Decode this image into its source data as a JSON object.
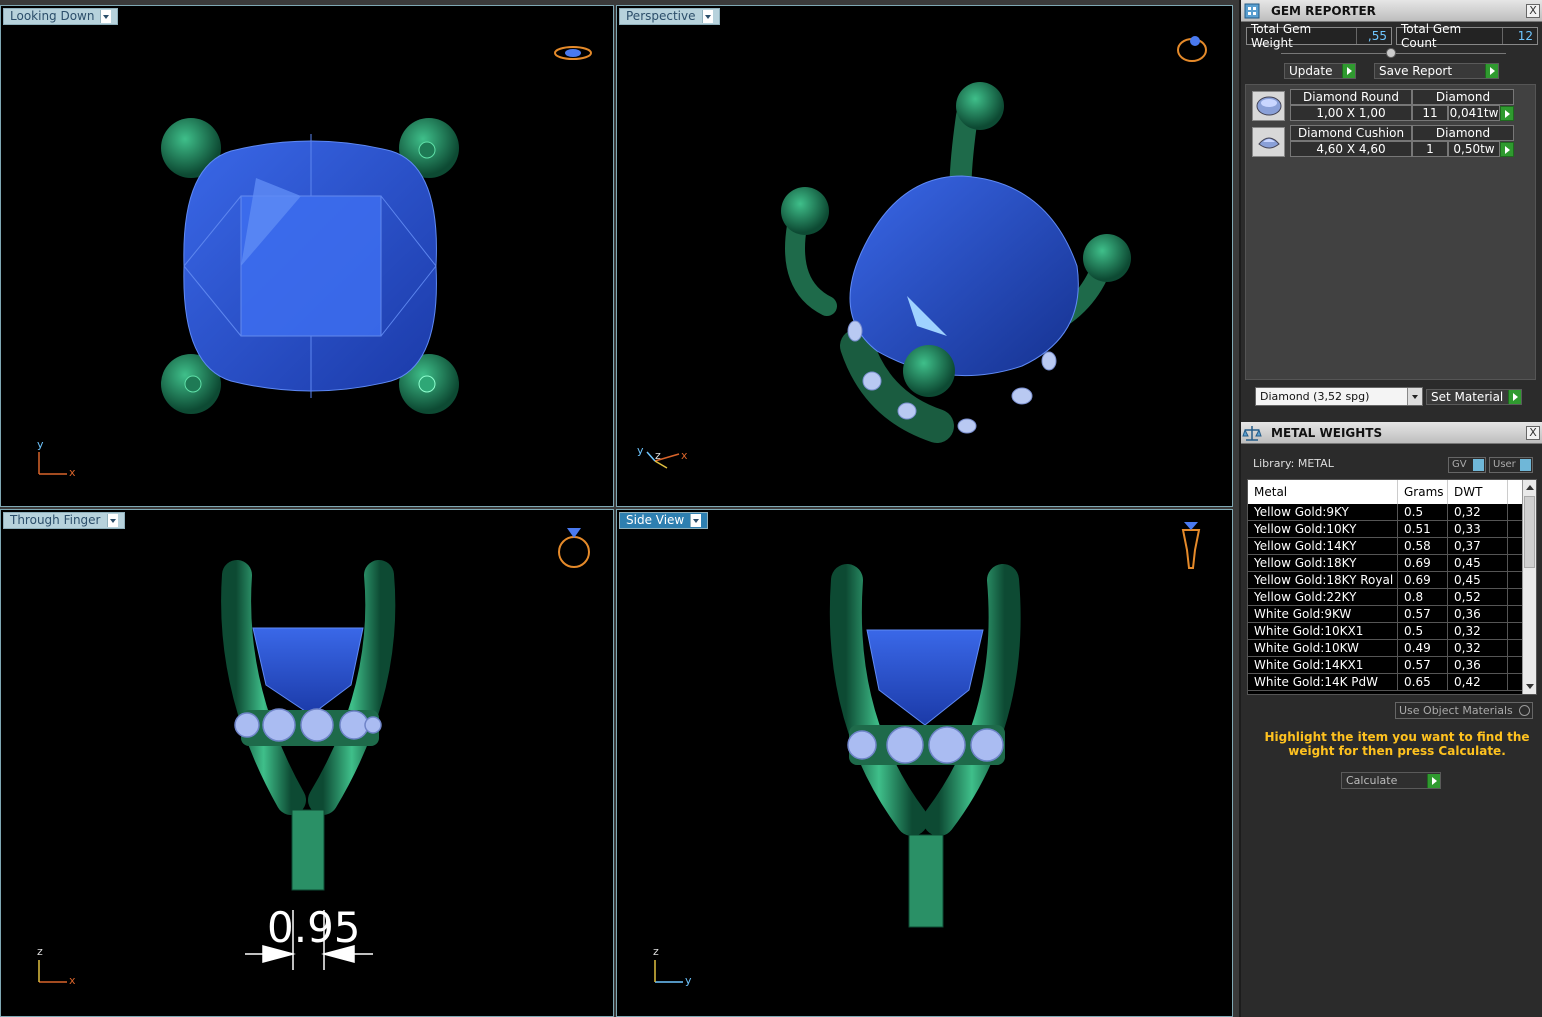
{
  "viewports": {
    "top_left": {
      "label": "Looking Down"
    },
    "top_right": {
      "label": "Perspective"
    },
    "bottom_left": {
      "label": "Through Finger",
      "dimension": "0.95"
    },
    "bottom_right": {
      "label": "Side View"
    }
  },
  "axes": {
    "x": "x",
    "y": "y",
    "z": "z"
  },
  "gem_reporter": {
    "title": "GEM REPORTER",
    "close": "X",
    "total_weight_label": "Total Gem Weight",
    "total_weight_value": ",55",
    "total_count_label": "Total Gem Count",
    "total_count_value": "12",
    "update_label": "Update",
    "save_report_label": "Save Report",
    "gems": [
      {
        "name": "Diamond Round",
        "material": "Diamond",
        "size": "1,00 X 1,00",
        "count": "11",
        "weight": "0,041tw"
      },
      {
        "name": "Diamond Cushion",
        "material": "Diamond",
        "size": "4,60 X 4,60",
        "count": "1",
        "weight": "0,50tw"
      }
    ],
    "material_select": "Diamond     (3,52 spg)",
    "set_material_label": "Set Material"
  },
  "metal_weights": {
    "title": "METAL WEIGHTS",
    "close": "X",
    "library_label": "Library: METAL",
    "gv_label": "GV",
    "user_label": "User",
    "columns": [
      "Metal",
      "Grams",
      "DWT"
    ],
    "rows": [
      [
        "Yellow Gold:9KY",
        "0.5",
        "0,32"
      ],
      [
        "Yellow Gold:10KY",
        "0.51",
        "0,33"
      ],
      [
        "Yellow Gold:14KY",
        "0.58",
        "0,37"
      ],
      [
        "Yellow Gold:18KY",
        "0.69",
        "0,45"
      ],
      [
        "Yellow Gold:18KY Royal",
        "0.69",
        "0,45"
      ],
      [
        "Yellow Gold:22KY",
        "0.8",
        "0,52"
      ],
      [
        "White Gold:9KW",
        "0.57",
        "0,36"
      ],
      [
        "White Gold:10KX1",
        "0.5",
        "0,32"
      ],
      [
        "White Gold:10KW",
        "0.49",
        "0,32"
      ],
      [
        "White Gold:14KX1",
        "0.57",
        "0,36"
      ],
      [
        "White Gold:14K PdW",
        "0.65",
        "0,42"
      ]
    ],
    "use_object_materials": "Use Object Materials",
    "hint": "Highlight the item you want to find the weight for then press Calculate.",
    "calculate_label": "Calculate"
  },
  "colors": {
    "gem_blue": "#2a4fd0",
    "gem_light": "#4a7af0",
    "metal_green": "#1e7a55",
    "metal_light": "#3fbf8a",
    "accent": "#2e7fb0"
  }
}
